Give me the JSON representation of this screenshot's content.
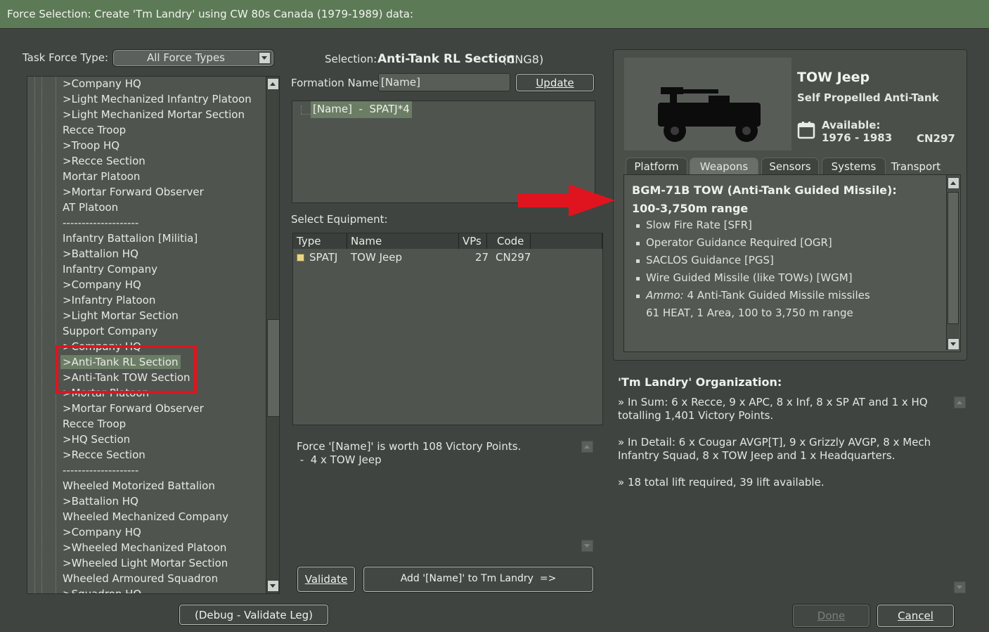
{
  "window": {
    "title": "Force Selection: Create 'Tm Landry' using CW 80s Canada (1979-1989) data:"
  },
  "task_force": {
    "label": "Task Force Type:",
    "selected": "All Force Types"
  },
  "tree_items": [
    ">Company HQ",
    ">Light Mechanized Infantry Platoon",
    ">Light Mechanized Mortar Section",
    "Recce Troop",
    ">Troop HQ",
    ">Recce Section",
    "Mortar Platoon",
    ">Mortar Forward Observer",
    "AT Platoon",
    "--------------------",
    "Infantry Battalion [Militia]",
    ">Battalion HQ",
    "Infantry Company",
    ">Company HQ",
    ">Infantry Platoon",
    ">Light Mortar Section",
    "Support Company",
    ">Company HQ",
    ">Anti-Tank RL Section",
    ">Anti-Tank TOW Section",
    ">Mortar Platoon",
    ">Mortar Forward Observer",
    "Recce Troop",
    ">HQ Section",
    ">Recce Section",
    "--------------------",
    "Wheeled Motorized Battalion",
    ">Battalion HQ",
    "Wheeled Mechanized Company",
    ">Company HQ",
    ">Wheeled Mechanized Platoon",
    ">Wheeled Light Mortar Section",
    "Wheeled Armoured Squadron",
    ">Squadron HQ"
  ],
  "selection": {
    "label": "Selection:",
    "name": "Anti-Tank RL Section",
    "code": "(CNG8)"
  },
  "formation": {
    "label": "Formation Name:",
    "value": "[Name]",
    "update_label": "Update",
    "node": "[Name]  -  SPATJ*4"
  },
  "equipment": {
    "label": "Select Equipment:",
    "columns": [
      "Type",
      "Name",
      "VPs",
      "Code"
    ],
    "rows": [
      {
        "type": "SPATJ",
        "name": "TOW Jeep",
        "vps": "27",
        "code": "CN297"
      }
    ]
  },
  "force_summary": {
    "line1": "Force '[Name]' is worth 108 Victory Points.",
    "line2": " -  4 x TOW Jeep"
  },
  "buttons": {
    "validate": "Validate",
    "add": "Add '[Name]' to Tm Landry  =>",
    "debug": "(Debug - Validate Leg)",
    "done": "Done",
    "cancel": "Cancel"
  },
  "unit": {
    "name": "TOW Jeep",
    "role": "Self Propelled Anti-Tank",
    "available_label": "Available:",
    "available_years": "1976 - 1983",
    "code": "CN297"
  },
  "tabs": [
    "Platform",
    "Weapons",
    "Sensors",
    "Systems",
    "Transport"
  ],
  "weapon": {
    "title": "BGM-71B TOW (Anti-Tank Guided Missile):",
    "range": "100-3,750m range",
    "traits": [
      "Slow Fire Rate [SFR]",
      "Operator Guidance Required [OGR]",
      "SACLOS Guidance [PGS]",
      "Wire Guided Missile (like TOWs) [WGM]"
    ],
    "ammo_label": "Ammo:",
    "ammo": " 4 Anti-Tank Guided Missile missiles",
    "ammo_detail": "61 HEAT, 1 Area, 100 to 3,750 m range"
  },
  "organization": {
    "title": "'Tm Landry' Organization:",
    "sum1": "» In Sum: 6 x Recce, 9 x APC, 8 x Inf, 8 x SP AT and 1 x HQ",
    "sum2": "totalling 1,401 Victory Points.",
    "detail1": "» In Detail: 6 x Cougar AVGP[T], 9 x Grizzly AVGP, 8 x Mech",
    "detail2": "Infantry Squad, 8 x TOW Jeep and 1 x Headquarters.",
    "lift": "» 18 total lift required, 39 lift available."
  },
  "colors": {
    "title_bar": "#5d7a57",
    "background": "#3f4441",
    "highlight_red": "#e0141e"
  }
}
